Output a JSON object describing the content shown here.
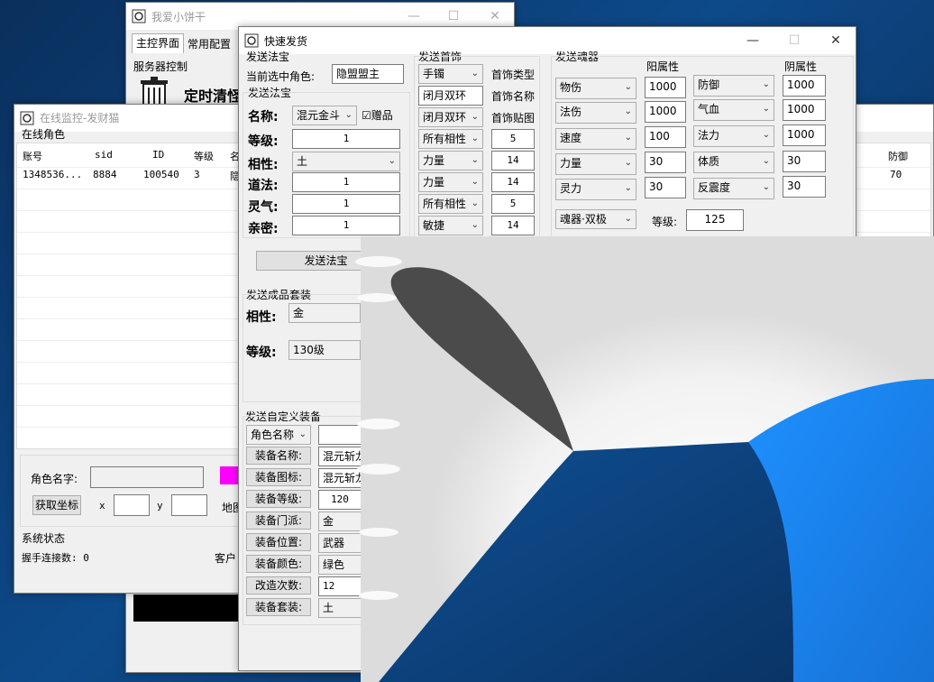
{
  "main_window": {
    "title": "我爱小饼干",
    "tabs": [
      "主控界面",
      "常用配置"
    ],
    "server_group": "服务器控制",
    "timer_label": "定时清怪"
  },
  "monitor_window": {
    "title": "在线监控-发财猫",
    "online_label": "在线角色",
    "columns": [
      "账号",
      "sid",
      "ID",
      "等级",
      "名"
    ],
    "extra_column": "防御",
    "row": [
      "1348536...",
      "8884",
      "100540",
      "3",
      "隐"
    ],
    "row_extra": "70",
    "role_name_label": "角色名字:",
    "get_coords_button": "获取坐标",
    "x_label": "x",
    "y_label": "y",
    "map_label": "地图",
    "system_status_label": "系统状态",
    "handshake_label": "握手连接数: 0",
    "client_label": "客户"
  },
  "quick_window": {
    "title": "快速发货",
    "treasure": {
      "group_label": "发送法宝",
      "current_role_label": "当前选中角色:",
      "current_role_value": "隐盟盟主",
      "sub_group_label": "发送法宝",
      "name_label": "名称:",
      "name_value": "混元金斗",
      "gift_label": "赠品",
      "level_label": "等级:",
      "level_value": "1",
      "phase_label": "相性:",
      "phase_value": "土",
      "dao_label": "道法:",
      "dao_value": "1",
      "spirit_label": "灵气:",
      "spirit_value": "1",
      "intimacy_label": "亲密:",
      "intimacy_value": "1",
      "send_button": "发送法宝"
    },
    "jewelry": {
      "group_label": "发送首饰",
      "type_value": "手镯",
      "type_label": "首饰类型",
      "name_value": "闭月双环",
      "name_label": "首饰名称",
      "sticker_value": "闭月双环",
      "sticker_label": "首饰贴图",
      "attrs": [
        {
          "sel": "所有相性",
          "val": "5"
        },
        {
          "sel": "力量",
          "val": "14"
        },
        {
          "sel": "力量",
          "val": "14"
        },
        {
          "sel": "所有相性",
          "val": "5"
        },
        {
          "sel": "敏捷",
          "val": "14"
        }
      ]
    },
    "soul": {
      "group_label": "发送魂器",
      "yang_label": "阳属性",
      "yin_label": "阴属性",
      "rows": [
        {
          "yang_sel": "物伤",
          "yang_val": "1000",
          "yin_sel": "防御",
          "yin_val": "1000"
        },
        {
          "yang_sel": "法伤",
          "yang_val": "1000",
          "yin_sel": "气血",
          "yin_val": "1000"
        },
        {
          "yang_sel": "速度",
          "yang_val": "100",
          "yin_sel": "法力",
          "yin_val": "1000"
        },
        {
          "yang_sel": "力量",
          "yang_val": "30",
          "yin_sel": "体质",
          "yin_val": "30"
        },
        {
          "yang_sel": "灵力",
          "yang_val": "30",
          "yin_sel": "反震度",
          "yin_val": "30"
        }
      ],
      "type_value": "魂器·双极",
      "level_label": "等级:",
      "level_value": "125"
    },
    "suit": {
      "group_label": "发送成品套装",
      "phase_label": "相性:",
      "phase_value": "金",
      "level_label": "等级:",
      "level_value": "130级"
    },
    "custom": {
      "group_label": "发送自定义装备",
      "role_sel": "角色名称",
      "fields": [
        {
          "label": "装备名称:",
          "value": "混元斩龙"
        },
        {
          "label": "装备图标:",
          "value": "混元斩龙"
        },
        {
          "label": "装备等级:",
          "value": "120"
        },
        {
          "label": "装备门派:",
          "value": "金"
        },
        {
          "label": "装备位置:",
          "value": "武器"
        },
        {
          "label": "装备颜色:",
          "value": "绿色"
        },
        {
          "label": "改造次数:",
          "value": "12"
        },
        {
          "label": "装备套装:",
          "value": "土"
        }
      ]
    }
  },
  "colors": {
    "accent_magenta": "#ff00ff",
    "desktop_blue": "#0d4a8a",
    "light_blue": "#1e90ff"
  }
}
